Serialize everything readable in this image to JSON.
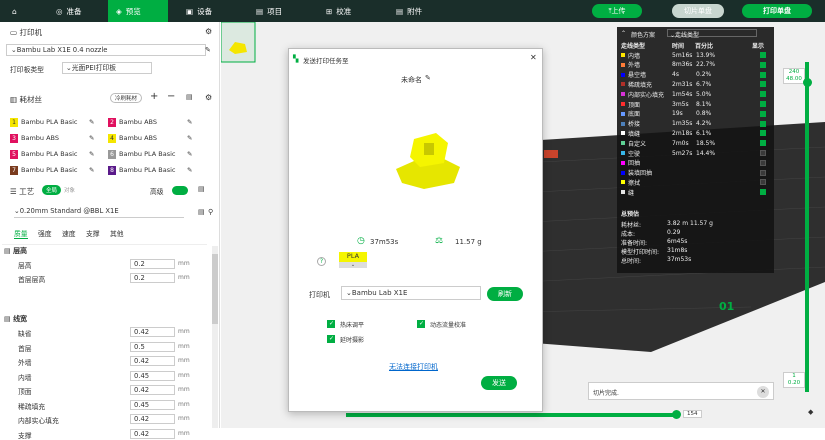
{
  "topbar": {
    "tabs": [
      {
        "label": "准备"
      },
      {
        "label": "预览"
      },
      {
        "label": "设备"
      },
      {
        "label": "项目"
      },
      {
        "label": "校准"
      },
      {
        "label": "附件"
      }
    ],
    "upload": "上传",
    "slice": "切片单盘",
    "print": "打印单盘",
    "home_icon": "home-icon"
  },
  "printer": {
    "section": "打印机",
    "name": "Bambu Lab X1E 0.4 nozzle",
    "plate_label": "打印板类型",
    "plate_value": "光面PEI打印板"
  },
  "filament": {
    "section": "耗材丝",
    "sync_label": "冷刷耗材",
    "items": [
      {
        "num": "1",
        "name": "Bambu PLA Basic",
        "color": "#f5e600",
        "text": "#333"
      },
      {
        "num": "2",
        "name": "Bambu ABS",
        "color": "#e0115f",
        "text": "#fff"
      },
      {
        "num": "3",
        "name": "Bambu ABS",
        "color": "#e0115f",
        "text": "#fff"
      },
      {
        "num": "4",
        "name": "Bambu ABS",
        "color": "#f5e600",
        "text": "#333"
      },
      {
        "num": "5",
        "name": "Bambu PLA Basic",
        "color": "#e0115f",
        "text": "#fff"
      },
      {
        "num": "6",
        "name": "Bambu PLA Basic",
        "color": "#999999",
        "text": "#fff"
      },
      {
        "num": "7",
        "name": "Bambu PLA Basic",
        "color": "#7a3b1e",
        "text": "#fff"
      },
      {
        "num": "8",
        "name": "Bambu PLA Basic",
        "color": "#5a1a8a",
        "text": "#fff"
      }
    ]
  },
  "process": {
    "section": "工艺",
    "global": "全局",
    "object": "对象",
    "advanced": "高级",
    "preset": "0.20mm Standard @BBL X1E",
    "tabs": [
      "质量",
      "强度",
      "速度",
      "支撑",
      "其他"
    ],
    "group1": "层高",
    "group2": "线宽",
    "params": [
      {
        "label": "层高",
        "value": "0.2",
        "unit": "mm"
      },
      {
        "label": "首层层高",
        "value": "0.2",
        "unit": "mm"
      }
    ],
    "params2": [
      {
        "label": "缺省",
        "value": "0.42",
        "unit": "mm"
      },
      {
        "label": "首层",
        "value": "0.5",
        "unit": "mm"
      },
      {
        "label": "外墙",
        "value": "0.42",
        "unit": "mm"
      },
      {
        "label": "内墙",
        "value": "0.45",
        "unit": "mm"
      },
      {
        "label": "顶面",
        "value": "0.42",
        "unit": "mm"
      },
      {
        "label": "稀疏填充",
        "value": "0.45",
        "unit": "mm"
      },
      {
        "label": "内部实心填充",
        "value": "0.42",
        "unit": "mm"
      },
      {
        "label": "支撑",
        "value": "0.42",
        "unit": "mm"
      }
    ]
  },
  "dialog": {
    "title": "发送打印任务至",
    "name": "未命名",
    "time": "37m53s",
    "weight": "11.57 g",
    "help": "?",
    "filament_tag": "PLA",
    "printer_label": "打印机",
    "printer_value": "Bambu Lab X1E",
    "refresh": "刷新",
    "opt1": "热床调平",
    "opt2": "动态流量校准",
    "opt3": "延时摄影",
    "cannot_connect": "无法连接打印机",
    "send": "发送"
  },
  "legend": {
    "scheme_label": "颜色方案",
    "scheme_value": "走线类型",
    "cols": [
      "走线类型",
      "时间",
      "百分比",
      "显示"
    ],
    "rows": [
      {
        "name": "内墙",
        "time": "5m16s",
        "pct": "13.9%",
        "color": "#ffe600",
        "on": true
      },
      {
        "name": "外墙",
        "time": "8m36s",
        "pct": "22.7%",
        "color": "#ff7d38",
        "on": true
      },
      {
        "name": "悬空墙",
        "time": "4s",
        "pct": "0.2%",
        "color": "#0000ff",
        "on": true
      },
      {
        "name": "稀疏填充",
        "time": "2m31s",
        "pct": "6.7%",
        "color": "#b03029",
        "on": true
      },
      {
        "name": "内部实心填充",
        "time": "1m54s",
        "pct": "5.0%",
        "color": "#d732d7",
        "on": true
      },
      {
        "name": "顶面",
        "time": "3m5s",
        "pct": "8.1%",
        "color": "#ff2e2e",
        "on": true
      },
      {
        "name": "底面",
        "time": "19s",
        "pct": "0.8%",
        "color": "#6699ff",
        "on": true
      },
      {
        "name": "桥接",
        "time": "1m35s",
        "pct": "4.2%",
        "color": "#4d80ba",
        "on": true
      },
      {
        "name": "填缝",
        "time": "2m18s",
        "pct": "6.1%",
        "color": "#ffffff",
        "on": true
      },
      {
        "name": "自定义",
        "time": "7m0s",
        "pct": "18.5%",
        "color": "#5ed194",
        "on": true
      },
      {
        "name": "空驶",
        "time": "5m27s",
        "pct": "14.4%",
        "color": "#38b6e8",
        "on": false
      },
      {
        "name": "回抽",
        "time": "",
        "pct": "",
        "color": "#ff00ff",
        "on": false
      },
      {
        "name": "装填回抽",
        "time": "",
        "pct": "",
        "color": "#0000ff",
        "on": false
      },
      {
        "name": "擦拭",
        "time": "",
        "pct": "",
        "color": "#ffff00",
        "on": false
      },
      {
        "name": "缝",
        "time": "",
        "pct": "",
        "color": "#e6e6e6",
        "on": true
      }
    ],
    "summary_title": "总预估",
    "summary": [
      {
        "k": "耗材丝:",
        "v": "3.82 m   11.57 g"
      },
      {
        "k": "成本:",
        "v": "0.29"
      },
      {
        "k": "准备时间:",
        "v": "6m45s"
      },
      {
        "k": "模型打印时间:",
        "v": "31m8s"
      },
      {
        "k": "总时间:",
        "v": "37m53s"
      }
    ]
  },
  "viewport": {
    "layer_top": "240",
    "layer_top2": "48.00",
    "layer_bottom": "1",
    "layer_bottom2": "0.20",
    "move": "154",
    "plate_num": "01",
    "toast": "切片完成."
  }
}
